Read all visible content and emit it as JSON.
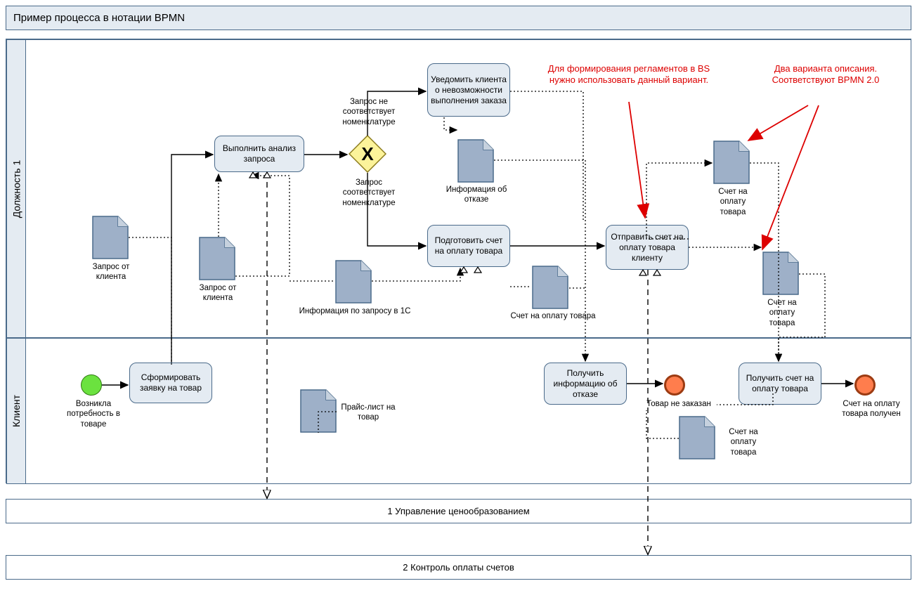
{
  "title": "Пример процесса в нотации BPMN",
  "lanes": {
    "lane1": "Должность 1",
    "lane2": "Клиент"
  },
  "tasks": {
    "form_request": "Сформировать заявку на товар",
    "analyze": "Выполнить анализ запроса",
    "notify_reject": "Уведомить клиента о невозможности выполнения заказа",
    "prepare_invoice": "Подготовить счет на оплату товара",
    "send_invoice": "Отправить счет на оплату товара клиенту",
    "get_reject": "Получить информацию об отказе",
    "get_invoice": "Получить счет на оплату товара"
  },
  "docs": {
    "req1": "Запрос от клиента",
    "req2": "Запрос от клиента",
    "info1c": "Информация по запросу в 1С",
    "rej_info": "Информация об отказе",
    "invoice1": "Счет на оплату товара",
    "invoice2": "Счет на оплату товара",
    "invoice3": "Счет на оплату товара",
    "invoice4": "Счет на оплату товара",
    "pricelist": "Прайс-лист на товар"
  },
  "gateway": {
    "cond_no": "Запрос не соответствует номенклатуре",
    "cond_yes": "Запрос соответствует номенклатуре"
  },
  "events": {
    "start": "Возникла потребность в товаре",
    "end_no": "Товар не заказан",
    "end_yes": "Счет на оплату товара получен"
  },
  "annotations": {
    "red1": "Для формирования регламентов в BS нужно использовать данный вариант.",
    "red2": "Два варианта описания. Соответствуют BPMN 2.0"
  },
  "bottom": {
    "b1": "1 Управление ценообразованием",
    "b2": "2 Контроль оплаты счетов"
  }
}
